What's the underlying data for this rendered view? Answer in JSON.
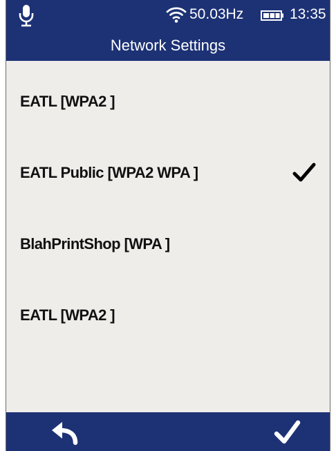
{
  "status_bar": {
    "mic_icon": "microphone-icon",
    "wifi_icon": "wifi-icon",
    "frequency": "50.03Hz",
    "battery_icon": "battery-icon",
    "time": "13:35"
  },
  "header": {
    "title": "Network Settings"
  },
  "networks": [
    {
      "label": "EATL [WPA2 ]",
      "selected": false
    },
    {
      "label": "EATL Public [WPA2 WPA ]",
      "selected": true
    },
    {
      "label": "BlahPrintShop [WPA ]",
      "selected": false
    },
    {
      "label": "EATL [WPA2 ]",
      "selected": false
    }
  ],
  "footer": {
    "back_icon": "back-arrow-icon",
    "confirm_icon": "checkmark-icon"
  },
  "colors": {
    "bar": "#1d3275",
    "background": "#efedea",
    "text": "#111111"
  }
}
